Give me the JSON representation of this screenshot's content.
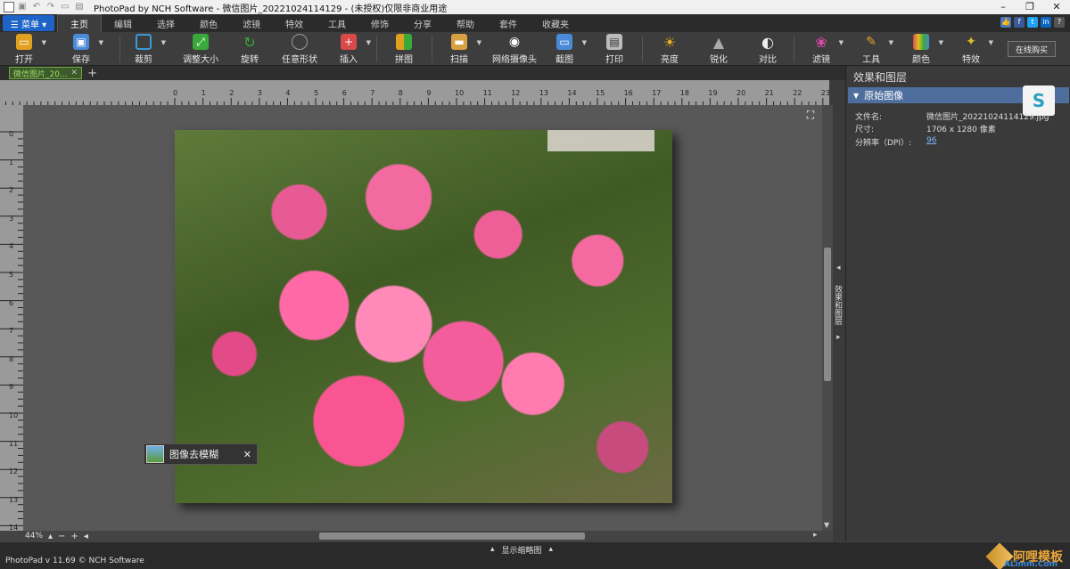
{
  "window": {
    "title": "PhotoPad by NCH Software - 微信图片_20221024114129 - (未授权)仅限非商业用途",
    "controls": [
      "–",
      "❐",
      "✕"
    ]
  },
  "menubar": {
    "menu_button": "☰ 菜单 ▾",
    "tabs": [
      "主页",
      "编辑",
      "选择",
      "颜色",
      "滤镜",
      "特效",
      "工具",
      "修饰",
      "分享",
      "帮助",
      "套件",
      "收藏夹"
    ],
    "active_tab": "主页"
  },
  "toolbar": {
    "tools": [
      {
        "label": "打开",
        "icon": "folder-icon",
        "color": "#e0a020"
      },
      {
        "label": "保存",
        "icon": "save-icon",
        "color": "#4a8ad8"
      },
      {
        "label": "裁剪",
        "icon": "crop-icon",
        "color": "#3a9ad8"
      },
      {
        "label": "调整大小",
        "icon": "resize-icon",
        "color": "#3aa83a"
      },
      {
        "label": "旋转",
        "icon": "rotate-icon",
        "color": "#3aa83a"
      },
      {
        "label": "任意形状",
        "icon": "shape-icon",
        "color": "#888888"
      },
      {
        "label": "插入",
        "icon": "insert-icon",
        "color": "#d84a4a"
      },
      {
        "label": "拼图",
        "icon": "collage-icon",
        "color": "#e0a020"
      },
      {
        "label": "扫描",
        "icon": "scanner-icon",
        "color": "#d8a040"
      },
      {
        "label": "网络摄像头",
        "icon": "webcam-icon",
        "color": "#cccccc"
      },
      {
        "label": "截图",
        "icon": "screenshot-icon",
        "color": "#4a8ad8"
      },
      {
        "label": "打印",
        "icon": "printer-icon",
        "color": "#bbbbbb"
      },
      {
        "label": "亮度",
        "icon": "sun-icon",
        "color": "#f0b020"
      },
      {
        "label": "锐化",
        "icon": "sharpen-icon",
        "color": "#aaaaaa"
      },
      {
        "label": "对比",
        "icon": "contrast-icon",
        "color": "#dddddd"
      },
      {
        "label": "滤镜",
        "icon": "filter-icon",
        "color": "#d84aa8"
      },
      {
        "label": "工具",
        "icon": "tools-icon",
        "color": "#e0a020"
      },
      {
        "label": "颜色",
        "icon": "color-icon",
        "color": "#d84a4a"
      },
      {
        "label": "特效",
        "icon": "effects-icon",
        "color": "#e0c020"
      }
    ],
    "buy_button": "在线购买"
  },
  "document": {
    "tab_label": "微信图片_20...",
    "tab_close": "✕",
    "add_tab": "+"
  },
  "rulers": {
    "top": [
      "0",
      "1",
      "2",
      "3",
      "4",
      "5",
      "6",
      "7",
      "8",
      "9",
      "10",
      "11",
      "12",
      "13",
      "14",
      "15",
      "16",
      "17",
      "18",
      "19",
      "20",
      "21",
      "22",
      "23"
    ],
    "left": [
      "0",
      "1",
      "2",
      "3",
      "4",
      "5",
      "6",
      "7",
      "8",
      "9",
      "10",
      "11",
      "12",
      "13",
      "14"
    ]
  },
  "canvas": {
    "toast_text": "图像去模糊",
    "toast_close": "✕",
    "zoom": "44%",
    "zoom_out": "−",
    "zoom_in": "+"
  },
  "side_tab": "效果和图层",
  "panel": {
    "title": "效果和图层",
    "layer_header": "原始图像",
    "file_label": "文件名:",
    "file_value": "微信图片_20221024114129.jpg",
    "size_label": "尺寸:",
    "size_value": "1706 x 1280 像素",
    "dpi_label": "分辨率（DPI）:",
    "dpi_value": "96"
  },
  "statusbar": {
    "version": "PhotoPad v 11.69 © NCH Software",
    "thumbnail_toggle": "显示缩略图",
    "watermark_text": "阿哩模板",
    "watermark_sub": "ALimm.Com"
  }
}
